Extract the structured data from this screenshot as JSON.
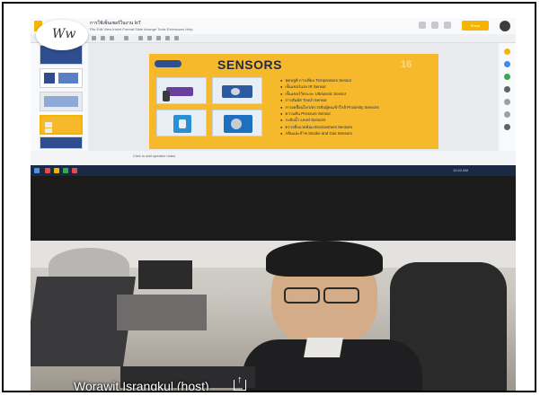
{
  "screen": {
    "doc_title": "การใช้เซ็นเซอร์ในงาน IoT",
    "menu": "File  Edit  View  Insert  Format  Slide  Arrange  Tools  Extensions  Help",
    "share_label": "Share",
    "slide": {
      "title": "SENSORS",
      "number": "16",
      "bullets": [
        "ชุดหลูดิ การเทียบ Temperature Sensor",
        "เซ็นเซอร์แสง IR Sensor",
        "เซ็นเซอร์วัดระยะ Ultrasonic Sensor",
        "การสัมผัส Touch Sensor",
        "การเคลื่อนไหว/ตรวจจับผู้คนเข้าใกล้ Proximity Sensors",
        "ความดัน Pressure Sensor",
        "ระดับน้ำ Level Sensors",
        "ตรวจสิ่งแวดล้อม Environment Sensors",
        "กลิ่นและก๊าซ Smoke and Gas Sensors"
      ]
    },
    "notes_placeholder": "Click to add speaker notes",
    "clock": "10:42 AM"
  },
  "participant": {
    "name": "Worawit Israngkul (host)",
    "share_icon": "screen-share-icon",
    "badge_initials": "Ww"
  },
  "colors": {
    "slide_bg": "#f6b92b",
    "slide_text": "#1f2a44",
    "accent": "#f4b400",
    "taskbar": "#1b2a44"
  }
}
